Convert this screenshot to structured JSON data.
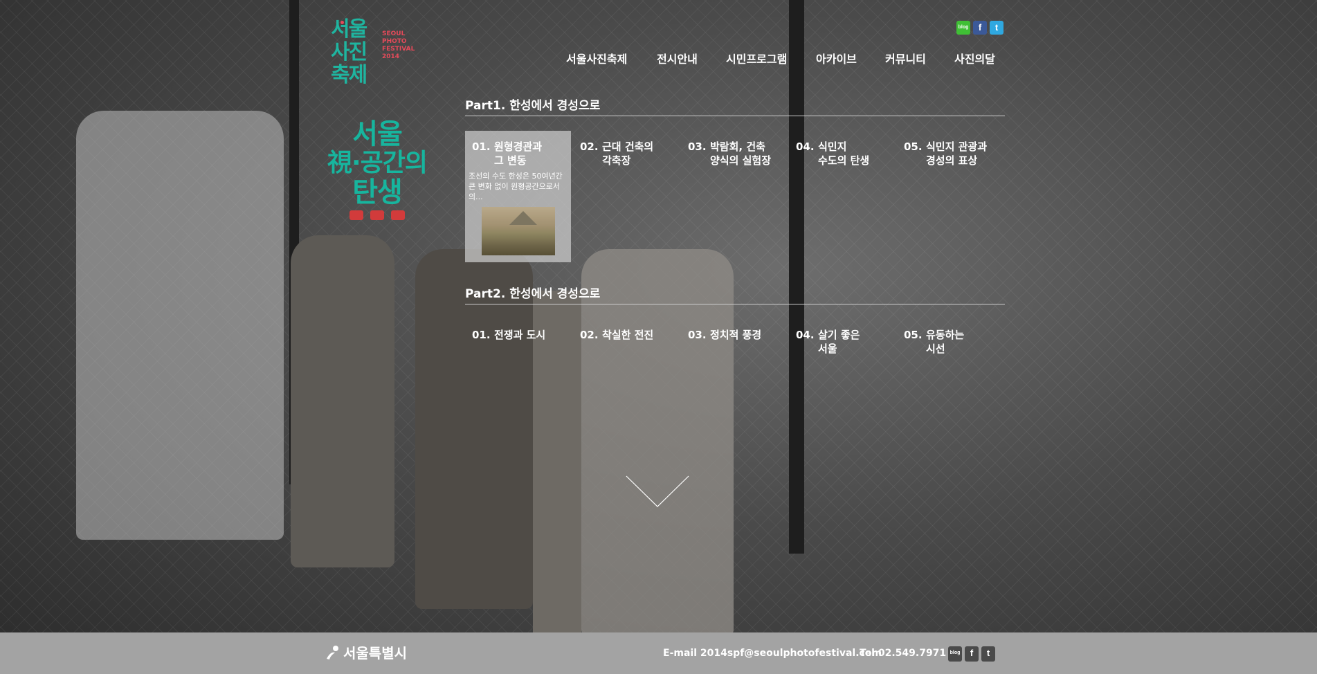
{
  "logo": {
    "hangul_lines": [
      "서울",
      "사진",
      "축제"
    ],
    "english_lines": [
      "SEOUL",
      "PHOTO",
      "FESTIVAL",
      "2014"
    ]
  },
  "exhibit_logo": {
    "line1": "서울",
    "line2": "視·공간의",
    "line3": "탄생"
  },
  "social_top": [
    {
      "icon": "blog-icon",
      "label": "blog"
    },
    {
      "icon": "facebook-icon",
      "label": "f"
    },
    {
      "icon": "twitter-icon",
      "label": "t"
    }
  ],
  "nav": {
    "items": [
      "서울사진축제",
      "전시안내",
      "시민프로그램",
      "아카이브",
      "커뮤니티",
      "사진의달"
    ]
  },
  "part1": {
    "title": "Part1. 한성에서 경성으로",
    "items": [
      {
        "num": "01.",
        "line1": "원형경관과",
        "line2": "그 변동"
      },
      {
        "num": "02.",
        "line1": "근대 건축의",
        "line2": "각축장"
      },
      {
        "num": "03.",
        "line1": "박람회, 건축",
        "line2": "양식의 실험장"
      },
      {
        "num": "04.",
        "line1": "식민지",
        "line2": "수도의 탄생"
      },
      {
        "num": "05.",
        "line1": "식민지 관광과",
        "line2": "경성의 표상"
      }
    ],
    "active_desc": "조선의 수도 한성은 50여년간 큰 변화 없이 원형공간으로서의..."
  },
  "part2": {
    "title": "Part2. 한성에서 경성으로",
    "items": [
      {
        "num": "01.",
        "line1": "전쟁과 도시",
        "line2": ""
      },
      {
        "num": "02.",
        "line1": "착실한 전진",
        "line2": ""
      },
      {
        "num": "03.",
        "line1": "정치적 풍경",
        "line2": ""
      },
      {
        "num": "04.",
        "line1": "살기 좋은",
        "line2": "서울"
      },
      {
        "num": "05.",
        "line1": "유동하는",
        "line2": "시선"
      }
    ]
  },
  "footer": {
    "city": "서울특별시",
    "email": "E-mail 2014spf@seoulphotofestival.com",
    "tel": "Tel 02.549.7971",
    "social": [
      {
        "icon": "blog-icon",
        "label": "blog"
      },
      {
        "icon": "facebook-icon",
        "label": "f"
      },
      {
        "icon": "twitter-icon",
        "label": "t"
      }
    ]
  },
  "colors": {
    "accent_teal": "#17b59e",
    "accent_red": "#e64a5a",
    "footer_bg": "#a3a3a3"
  }
}
